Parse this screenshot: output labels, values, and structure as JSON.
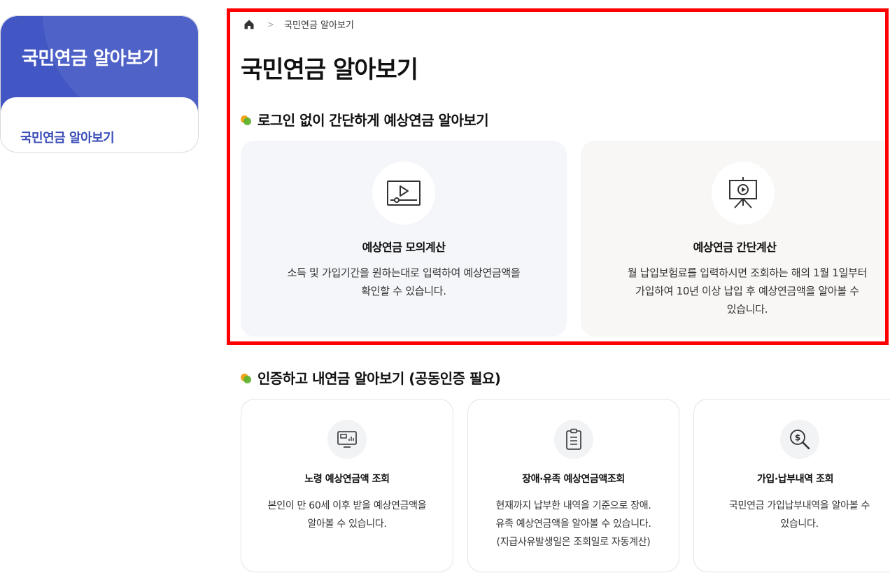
{
  "sidebar": {
    "title": "국민연금 알아보기",
    "items": [
      {
        "label": "국민연금 알아보기",
        "active": true
      }
    ],
    "accent_color": "#4257c4"
  },
  "breadcrumb": {
    "home_icon": "home-icon",
    "separator": ">",
    "current": "국민연금 알아보기"
  },
  "page_title": "국민연금 알아보기",
  "section_guest": {
    "title": "로그인 없이 간단하게 예상연금 알아보기",
    "cards": [
      {
        "icon": "video-play-icon",
        "title": "예상연금 모의계산",
        "desc_lines": [
          "소득 및 가입기간을 원하는대로 입력하여 예상연금액을",
          "확인할 수 있습니다."
        ]
      },
      {
        "icon": "presentation-play-icon",
        "title": "예상연금 간단계산",
        "desc_lines": [
          "월 납입보험료를 입력하시면 조회하는 해의 1월 1일부터",
          "가입하여 10년 이상 납입 후 예상연금액을 알아볼 수",
          "있습니다."
        ]
      }
    ]
  },
  "section_auth": {
    "title": "인증하고 내연금 알아보기 (공동인증 필요)",
    "cards": [
      {
        "icon": "monitor-chart-icon",
        "title": "노령 예상연금액 조회",
        "desc_lines": [
          "본인이 만 60세 이후 받을 예상연금액을",
          "알아볼 수 있습니다."
        ]
      },
      {
        "icon": "clipboard-icon",
        "title": "장애·유족 예상연금액조회",
        "desc_lines": [
          "현재까지 납부한 내역을 기준으로 장애.",
          "유족 예상연금액을 알아볼 수 있습니다.",
          "(지급사유발생일은 조회일로 자동계산)"
        ]
      },
      {
        "icon": "dollar-search-icon",
        "title": "가입·납부내역 조회",
        "desc_lines": [
          "국민연금 가입납부내역을 알아볼 수",
          "있습니다."
        ]
      }
    ]
  },
  "colors": {
    "highlight": "#ff0000",
    "dot_orange": "#f2a51c",
    "dot_green": "#5fb32e"
  }
}
